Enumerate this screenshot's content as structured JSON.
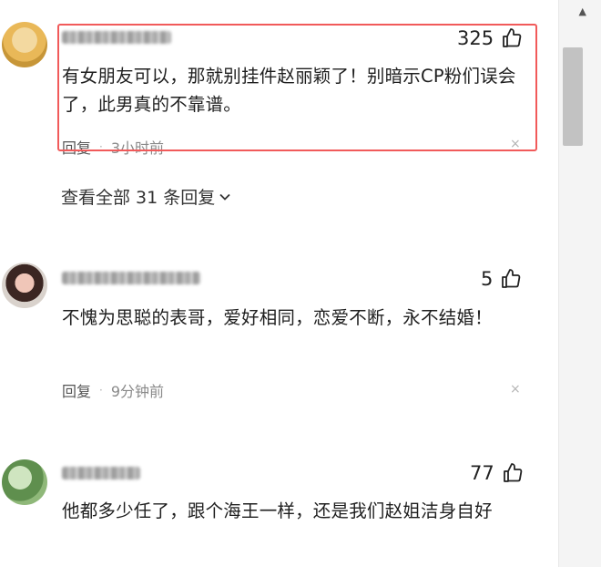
{
  "comments": [
    {
      "likes": "325",
      "text": "有女朋友可以，那就别挂件赵丽颖了！别暗示CP粉们误会了，此男真的不靠谱。",
      "reply_label": "回复",
      "time": "3小时前"
    },
    {
      "likes": "5",
      "text": "不愧为思聪的表哥，爱好相同，恋爱不断，永不结婚！",
      "reply_label": "回复",
      "time": "9分钟前"
    },
    {
      "likes": "77",
      "text": "他都多少任了，跟个海王一样，还是我们赵姐洁身自好"
    }
  ],
  "view_all_replies": "查看全部 31 条回复",
  "dot": "·",
  "close_glyph": "×",
  "scroll_up_glyph": "▲",
  "icons": {
    "like": "thumbs-up-icon",
    "expand": "chevron-down-icon"
  },
  "colors": {
    "highlight_border": "#f15a5a",
    "meta_text": "#8a8a8a"
  }
}
